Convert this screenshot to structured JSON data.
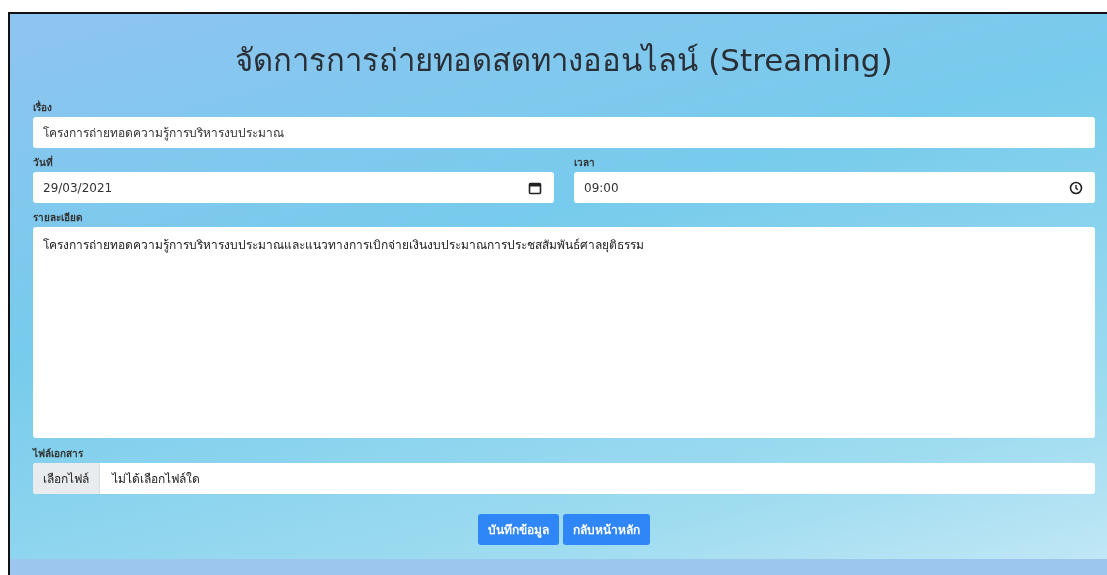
{
  "title": "จัดการการถ่ายทอดสดทางออนไลน์ (Streaming)",
  "subject": {
    "label": "เรื่อง",
    "value": "โครงการถ่ายทอดความรู้การบริหารงบประมาณ"
  },
  "date": {
    "label": "วันที่",
    "value": "29/03/2021"
  },
  "time": {
    "label": "เวลา",
    "value": "09:00"
  },
  "details": {
    "label": "รายละเอียด",
    "value": "โครงการถ่ายทอดความรู้การบริหารงบประมาณและแนวทางการเบิกจ่ายเงินงบประมาณการประชสสัมพันธ์ศาลยุติธรรม"
  },
  "file": {
    "label": "ไฟล์เอกสาร",
    "button": "เลือกไฟล์",
    "status": "ไม่ได้เลือกไฟล์ใด"
  },
  "buttons": [
    "บันทึกข้อมูล",
    "กลับหน้าหลัก"
  ]
}
